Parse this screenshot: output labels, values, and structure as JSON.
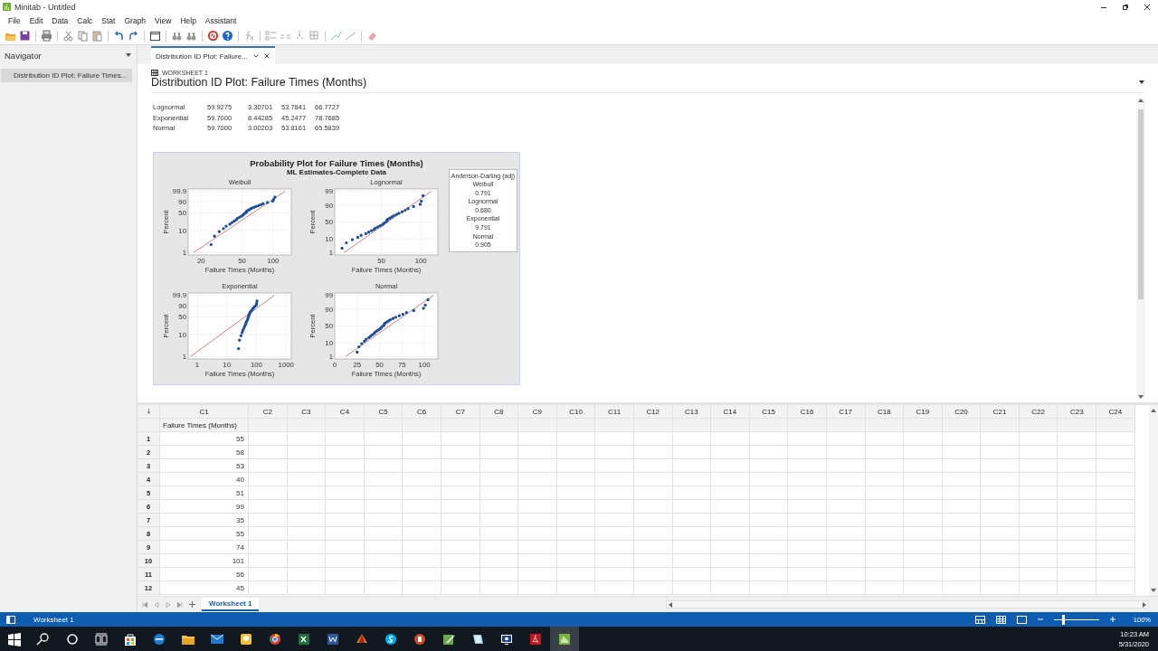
{
  "window": {
    "title": "Minitab - Untitled"
  },
  "menu": [
    "File",
    "Edit",
    "Data",
    "Calc",
    "Stat",
    "Graph",
    "View",
    "Help",
    "Assistant"
  ],
  "navigator": {
    "title": "Navigator",
    "items": [
      {
        "label": "Distribution ID Plot: Failure Times...",
        "selected": true
      }
    ]
  },
  "document_tabs": [
    {
      "label": "Distribution ID Plot: Failure...",
      "selected": true
    }
  ],
  "output": {
    "worksheet": "WORKSHEET 1",
    "title": "Distribution ID Plot: Failure Times (Months)",
    "table_rows": [
      [
        "Lognormal",
        "59.9275",
        "3.30701",
        "53.7841",
        "66.7727"
      ],
      [
        "Exponential",
        "59.7000",
        "8.44285",
        "45.2477",
        "78.7685"
      ],
      [
        "Normal",
        "59.7000",
        "3.00203",
        "53.8161",
        "65.5839"
      ]
    ],
    "graph": {
      "title": "Probability Plot for Failure Times (Months)",
      "subtitle": "ML Estimates-Complete Data",
      "legend": {
        "title": "Anderson-Darling (adj)",
        "items": [
          {
            "name": "Weibull",
            "value": "0.791"
          },
          {
            "name": "Lognormal",
            "value": "0.680"
          },
          {
            "name": "Exponential",
            "value": "9.791"
          },
          {
            "name": "Normal",
            "value": "0.905"
          }
        ]
      },
      "panels": [
        {
          "kind": "weibull",
          "title": "Weibull",
          "xlabel": "Failure Times (Months)",
          "ylabel": "Percent",
          "xticks": [
            "20",
            "50",
            "100"
          ],
          "yticks": [
            "99.9",
            "90",
            "50",
            "10",
            "1"
          ]
        },
        {
          "kind": "lognormal",
          "title": "Lognormal",
          "xlabel": "Failure Times (Months)",
          "ylabel": "Percent",
          "xticks": [
            "50",
            "100"
          ],
          "yticks": [
            "99",
            "90",
            "50",
            "10",
            "1"
          ]
        },
        {
          "kind": "exponential",
          "title": "Exponential",
          "xlabel": "Failure Times (Months)",
          "ylabel": "Percent",
          "xticks": [
            "1",
            "10",
            "100",
            "1000"
          ],
          "yticks": [
            "99.9",
            "90",
            "50",
            "10",
            "1"
          ]
        },
        {
          "kind": "normal",
          "title": "Normal",
          "xlabel": "Failure Times (Months)",
          "ylabel": "Percent",
          "xticks": [
            "0",
            "25",
            "50",
            "75",
            "100"
          ],
          "yticks": [
            "99",
            "90",
            "50",
            "10",
            "1"
          ]
        }
      ]
    }
  },
  "worksheet": {
    "columns": [
      "C1",
      "C2",
      "C3",
      "C4",
      "C5",
      "C6",
      "C7",
      "C8",
      "C9",
      "C10",
      "C11",
      "C12",
      "C13",
      "C14",
      "C15",
      "C16",
      "C17",
      "C18",
      "C19",
      "C20",
      "C21",
      "C22",
      "C23",
      "C24"
    ],
    "column_names": [
      "Failure Times (Months)"
    ],
    "rows": [
      {
        "number": "1",
        "values": [
          "55"
        ]
      },
      {
        "number": "2",
        "values": [
          "58"
        ]
      },
      {
        "number": "3",
        "values": [
          "53"
        ]
      },
      {
        "number": "4",
        "values": [
          "40"
        ]
      },
      {
        "number": "5",
        "values": [
          "51"
        ]
      },
      {
        "number": "6",
        "values": [
          "99"
        ]
      },
      {
        "number": "7",
        "values": [
          "35"
        ]
      },
      {
        "number": "8",
        "values": [
          "55"
        ]
      },
      {
        "number": "9",
        "values": [
          "74"
        ]
      },
      {
        "number": "10",
        "values": [
          "101"
        ]
      },
      {
        "number": "11",
        "values": [
          "56"
        ]
      },
      {
        "number": "12",
        "values": [
          "45"
        ]
      }
    ]
  },
  "sheet_tabs": [
    {
      "label": "Worksheet 1",
      "selected": true
    }
  ],
  "status_bar": {
    "text": "Worksheet 1",
    "zoom": "100%",
    "zoom_slider": {
      "level": 0.2
    }
  },
  "taskbar": {
    "time": "10:23 AM",
    "date": "5/31/2020"
  }
}
